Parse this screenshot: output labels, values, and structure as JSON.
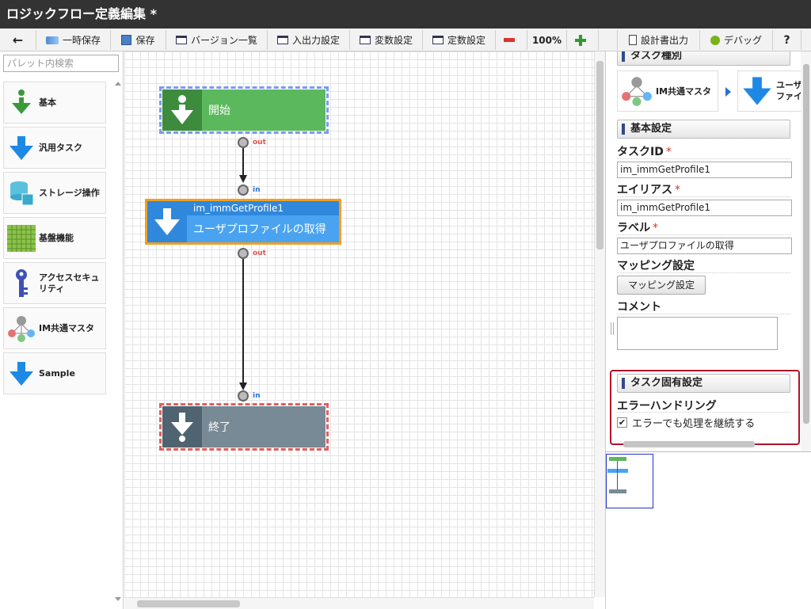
{
  "app": {
    "title": "ロジックフロー定義編集 *"
  },
  "toolbar": {
    "back": "←",
    "temp_save": "一時保存",
    "save": "保存",
    "version_list": "バージョン一覧",
    "io_settings": "入出力設定",
    "variable_settings": "変数設定",
    "constant_settings": "定数設定",
    "zoom": "100%",
    "spec_output": "設計書出力",
    "debug": "デバッグ",
    "help": "?"
  },
  "palette": {
    "search_placeholder": "パレット内検索",
    "items": [
      {
        "label": "基本",
        "icon": "green-download-icon"
      },
      {
        "label": "汎用タスク",
        "icon": "blue-arrow-down-icon"
      },
      {
        "label": "ストレージ操作",
        "icon": "storage-icon"
      },
      {
        "label": "基盤機能",
        "icon": "grid-icon"
      },
      {
        "label": "アクセスセキュリティ",
        "icon": "key-icon"
      },
      {
        "label": "IM共通マスタ",
        "icon": "network-master-icon"
      },
      {
        "label": "Sample",
        "icon": "blue-arrow-down-icon"
      }
    ]
  },
  "flow": {
    "start": {
      "label": "開始",
      "out": "out"
    },
    "task": {
      "id": "im_immGetProfile1",
      "label": "ユーザプロファイルの取得",
      "in": "in",
      "out": "out"
    },
    "end": {
      "label": "終了",
      "in": "in"
    }
  },
  "properties": {
    "task_type": {
      "header": "タスク種別",
      "category": "IM共通マスタ",
      "task_partial_line1": "ユーザ",
      "task_partial_line2": "ファイル"
    },
    "basic": {
      "header": "基本設定",
      "task_id_label": "タスクID",
      "task_id_value": "im_immGetProfile1",
      "alias_label": "エイリアス",
      "alias_value": "im_immGetProfile1",
      "label_label": "ラベル",
      "label_value": "ユーザプロファイルの取得",
      "mapping_label": "マッピング設定",
      "mapping_button": "マッピング設定",
      "comment_label": "コメント",
      "comment_value": "",
      "required_mark": "*"
    },
    "specific": {
      "header": "タスク固有設定",
      "error_handling_label": "エラーハンドリング",
      "continue_on_error": "エラーでも処理を継続する",
      "continue_checked_mark": "✔"
    }
  },
  "colors": {
    "start_node": "#5cb85c",
    "task_node": "#4aa3f0",
    "end_node": "#778a96",
    "selection": "#f0a020",
    "highlight": "#b0122a"
  }
}
